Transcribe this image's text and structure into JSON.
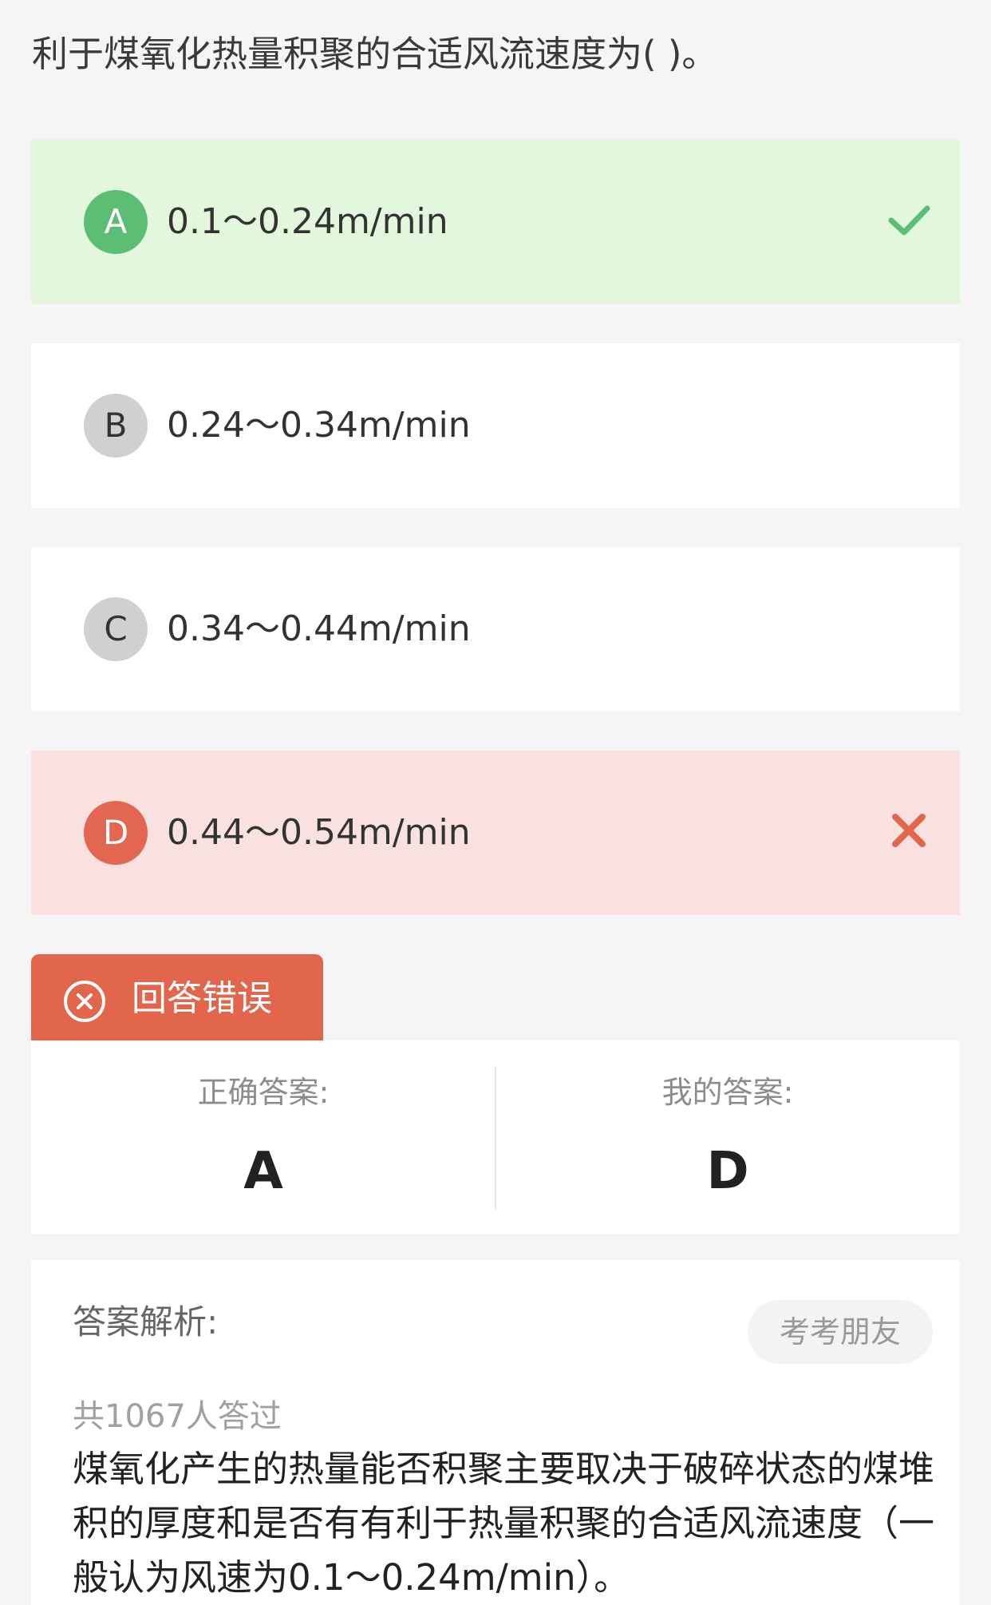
{
  "question": "利于煤氧化热量积聚的合适风流速度为( )。",
  "options": [
    {
      "letter": "A",
      "text": "0.1～0.24m/min",
      "state": "correct",
      "status_icon": "check-icon"
    },
    {
      "letter": "B",
      "text": "0.24～0.34m/min",
      "state": "normal"
    },
    {
      "letter": "C",
      "text": "0.34～0.44m/min",
      "state": "normal"
    },
    {
      "letter": "D",
      "text": "0.44～0.54m/min",
      "state": "wrong",
      "status_icon": "cross-icon"
    }
  ],
  "result": {
    "label": "回答错误",
    "icon": "x-circle-icon"
  },
  "answers": {
    "correct_caption": "正确答案:",
    "correct_value": "A",
    "mine_caption": "我的答案:",
    "mine_value": "D"
  },
  "analysis": {
    "title": "答案解析:",
    "friend_button": "考考朋友",
    "count": "共1067人答过",
    "body": "煤氧化产生的热量能否积聚主要取决于破碎状态的煤堆积的厚度和是否有有利于热量积聚的合适风流速度（一般认为风速为0.1～0.24m/min）。"
  },
  "colors": {
    "correct_bg": "#e3f7dc",
    "correct_accent": "#5cbd74",
    "wrong_bg": "#f8e1de",
    "wrong_accent": "#e2664c",
    "page_bg": "#f5f5f5"
  }
}
